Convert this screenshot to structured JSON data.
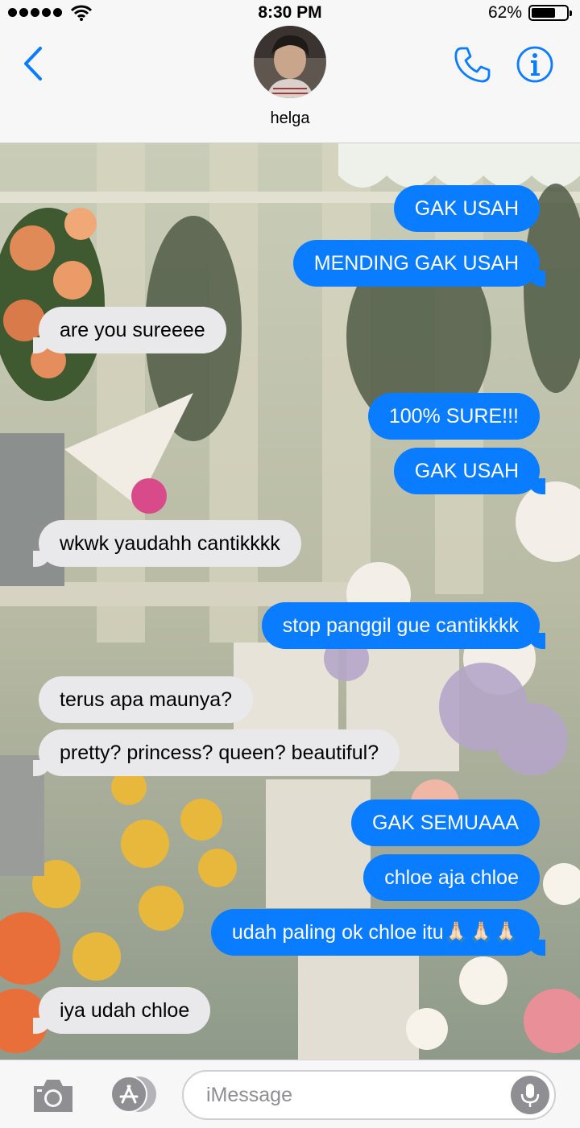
{
  "status_bar": {
    "time": "8:30 PM",
    "battery_percent": "62%",
    "battery_level": 0.62,
    "signal_bars": 5,
    "icons": [
      "signal-icon",
      "wifi-icon",
      "battery-icon"
    ]
  },
  "header": {
    "contact_name": "helga",
    "icons": [
      "back-chevron-icon",
      "phone-icon",
      "info-icon"
    ],
    "accent_color": "#0a7cff"
  },
  "messages": [
    {
      "direction": "outgoing",
      "text": "GAK USAH"
    },
    {
      "direction": "outgoing",
      "text": "MENDING GAK USAH"
    },
    {
      "direction": "incoming",
      "text": "are you sureeee"
    },
    {
      "direction": "outgoing",
      "text": "100% SURE!!!"
    },
    {
      "direction": "outgoing",
      "text": "GAK USAH"
    },
    {
      "direction": "incoming",
      "text": "wkwk yaudahh cantikkkk"
    },
    {
      "direction": "outgoing",
      "text": "stop panggil gue cantikkkk"
    },
    {
      "direction": "incoming",
      "text": "terus apa maunya?"
    },
    {
      "direction": "incoming",
      "text": "pretty? princess? queen? beautiful?"
    },
    {
      "direction": "outgoing",
      "text": "GAK SEMUAAA"
    },
    {
      "direction": "outgoing",
      "text": "chloe aja chloe"
    },
    {
      "direction": "outgoing",
      "text": "udah paling ok chloe itu🙏🏻🙏🏻🙏🏻"
    },
    {
      "direction": "incoming",
      "text": "iya udah chloe"
    }
  ],
  "input_bar": {
    "placeholder": "iMessage",
    "value": "",
    "icons": [
      "camera-icon",
      "app-store-icon",
      "microphone-icon"
    ]
  },
  "colors": {
    "outgoing_bubble": "#0a7cff",
    "incoming_bubble": "#e9e9eb",
    "bar_background": "#f7f7f7"
  }
}
